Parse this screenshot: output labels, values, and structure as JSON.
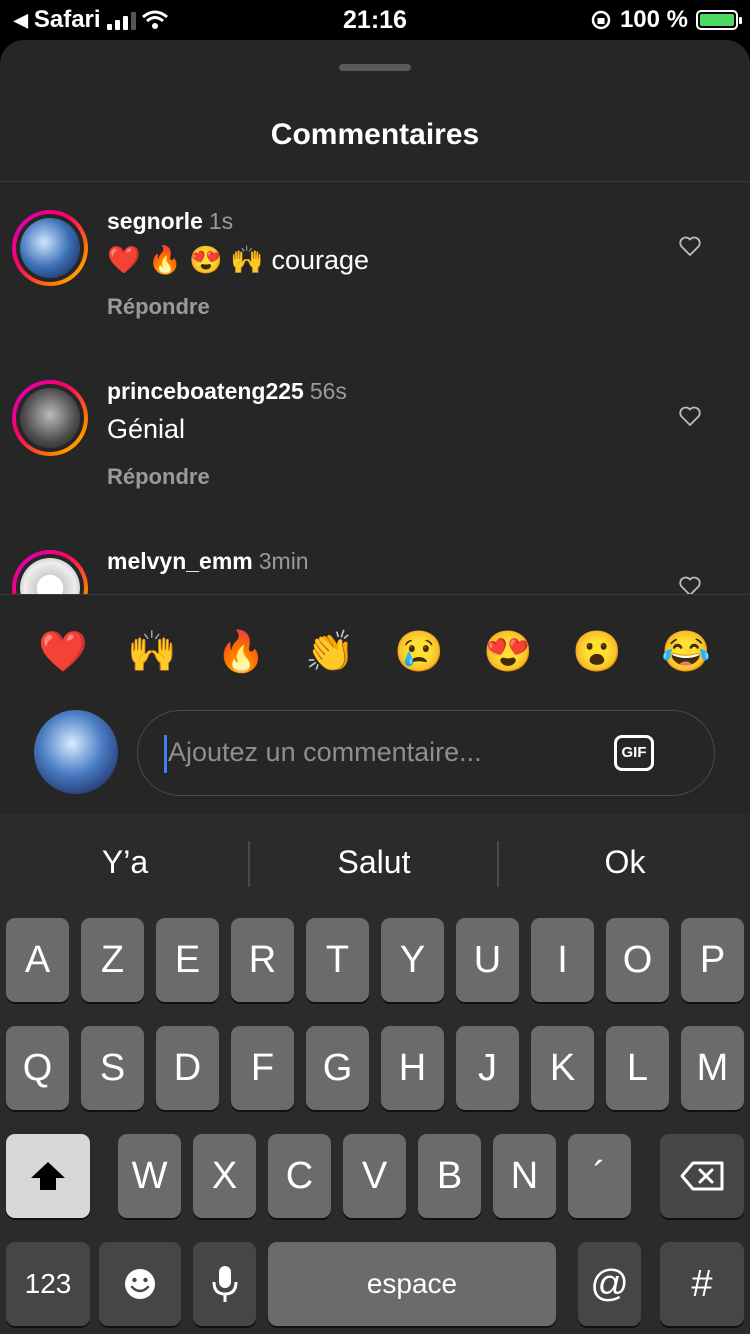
{
  "status_bar": {
    "back_app": "Safari",
    "time": "21:16",
    "battery_percent": "100 %",
    "battery_level": 1.0
  },
  "sheet": {
    "title": "Commentaires"
  },
  "comments": [
    {
      "username": "segnorle",
      "time": "1s",
      "text": "❤️ 🔥 😍 🙌 courage",
      "reply_label": "Répondre"
    },
    {
      "username": "princeboateng225",
      "time": "56s",
      "text": "Génial",
      "reply_label": "Répondre"
    },
    {
      "username": "melvyn_emm",
      "time": "3min",
      "text": "",
      "reply_label": ""
    }
  ],
  "quick_reactions": [
    "❤️",
    "🙌",
    "🔥",
    "👏",
    "😢",
    "😍",
    "😮",
    "😂"
  ],
  "composer": {
    "placeholder": "Ajoutez un commentaire...",
    "gif_label": "GIF"
  },
  "keyboard": {
    "suggestions": [
      "Y’a",
      "Salut",
      "Ok"
    ],
    "row1": [
      "A",
      "Z",
      "E",
      "R",
      "T",
      "Y",
      "U",
      "I",
      "O",
      "P"
    ],
    "row2": [
      "Q",
      "S",
      "D",
      "F",
      "G",
      "H",
      "J",
      "K",
      "L",
      "M"
    ],
    "row3": [
      "W",
      "X",
      "C",
      "V",
      "B",
      "N",
      "´"
    ],
    "numbers_label": "123",
    "space_label": "espace",
    "at_label": "@",
    "hash_label": "#"
  },
  "colors": {
    "sheet_bg": "#262626",
    "story_ring_start": "#d300c5",
    "story_ring_end": "#ffd600",
    "caret": "#3b82f6",
    "battery_fill": "#4cd964"
  }
}
